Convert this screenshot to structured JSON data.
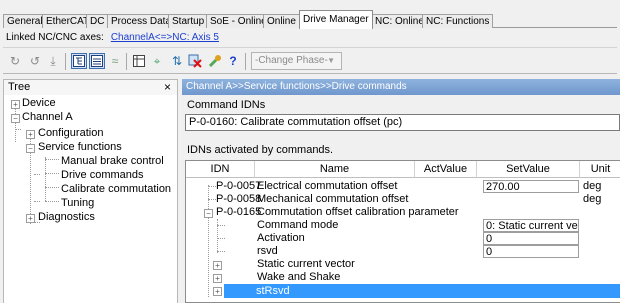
{
  "tabs": [
    "General",
    "EtherCAT",
    "DC",
    "Process Data",
    "Startup",
    "SoE - Online",
    "Online",
    "Drive Manager",
    "NC: Online",
    "NC: Functions"
  ],
  "active_tab": "Drive Manager",
  "linked": {
    "label": "Linked NC/CNC axes:",
    "link": "ChannelA<=>NC: Axis 5"
  },
  "toolbar": {
    "icons": [
      "refresh-icon",
      "refresh-alt-icon",
      "download-icon",
      "tree-view-icon",
      "list-view-icon",
      "wave-icon",
      "table-icon",
      "scope-icon",
      "sort-icon",
      "cross-icon",
      "wrench-icon",
      "help-icon"
    ],
    "phase_placeholder": "-Change Phase-"
  },
  "tree": {
    "title": "Tree",
    "close": "×",
    "nodes": [
      "Device",
      "Channel A",
      "Configuration",
      "Service functions",
      "Manual brake control",
      "Drive commands",
      "Calibrate commutation",
      "Tuning",
      "Diagnostics"
    ]
  },
  "breadcrumb": "Channel A>>Service functions>>Drive commands",
  "command": {
    "label": "Command IDNs",
    "value": "P-0-0160: Calibrate commutation offset (pc)"
  },
  "table": {
    "label": "IDNs activated by commands.",
    "headers": [
      "IDN",
      "Name",
      "ActValue",
      "SetValue",
      "Unit"
    ],
    "rows": [
      {
        "idn": "P-0-0057",
        "name": "Electrical commutation offset",
        "act": "",
        "set": "270.00",
        "unit": "deg"
      },
      {
        "idn": "P-0-0058",
        "name": "Mechanical commutation offset",
        "act": "",
        "set": "",
        "unit": "deg"
      },
      {
        "idn": "P-0-0165",
        "name": "Commutation offset calibration parameter",
        "act": "",
        "set": "",
        "unit": ""
      },
      {
        "idn": "",
        "name": "Command mode",
        "act": "",
        "set": "0: Static current vector",
        "unit": ""
      },
      {
        "idn": "",
        "name": "Activation",
        "act": "",
        "set": "0",
        "unit": ""
      },
      {
        "idn": "",
        "name": "rsvd",
        "act": "",
        "set": "0",
        "unit": ""
      },
      {
        "idn": "",
        "name": "Static current vector",
        "act": "",
        "set": "",
        "unit": ""
      },
      {
        "idn": "",
        "name": "Wake and Shake",
        "act": "",
        "set": "",
        "unit": ""
      },
      {
        "idn": "",
        "name": "stRsvd",
        "act": "",
        "set": "",
        "unit": ""
      }
    ]
  },
  "colors": {
    "selection": "#3399ff",
    "breadcrumb": "#7aa0d4",
    "link": "#1a3fcf"
  }
}
